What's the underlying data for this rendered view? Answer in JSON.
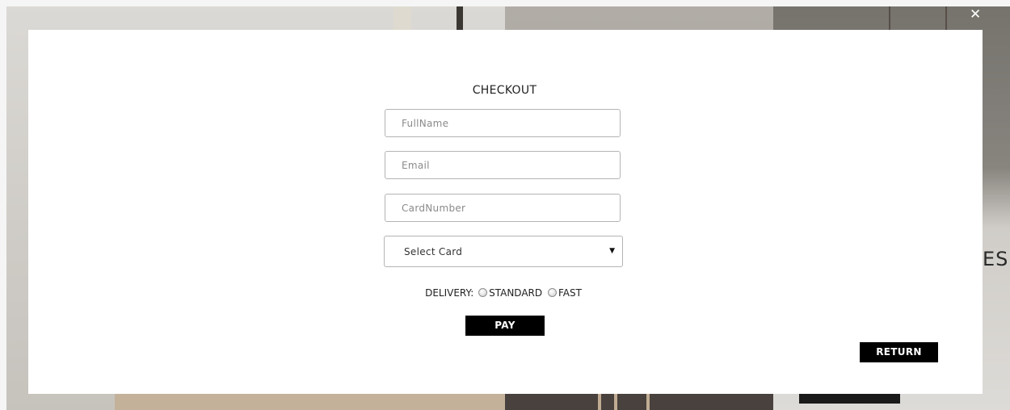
{
  "modal": {
    "title": "CHECKOUT",
    "close_icon": "close-icon"
  },
  "form": {
    "fullname_placeholder": "FullName",
    "email_placeholder": "Email",
    "cardnumber_placeholder": "CardNumber",
    "select_card_value": "Select Card",
    "select_caret": "▼",
    "delivery_label": "DELIVERY:",
    "delivery_options": [
      "STANDARD",
      "FAST"
    ],
    "pay_label": "PAY"
  },
  "return_label": "RETURN",
  "background": {
    "heading_fragment": "ES"
  },
  "colors": {
    "button_bg": "#000000",
    "button_text": "#ffffff",
    "modal_bg": "#ffffff",
    "field_border": "#b4b4b4"
  }
}
